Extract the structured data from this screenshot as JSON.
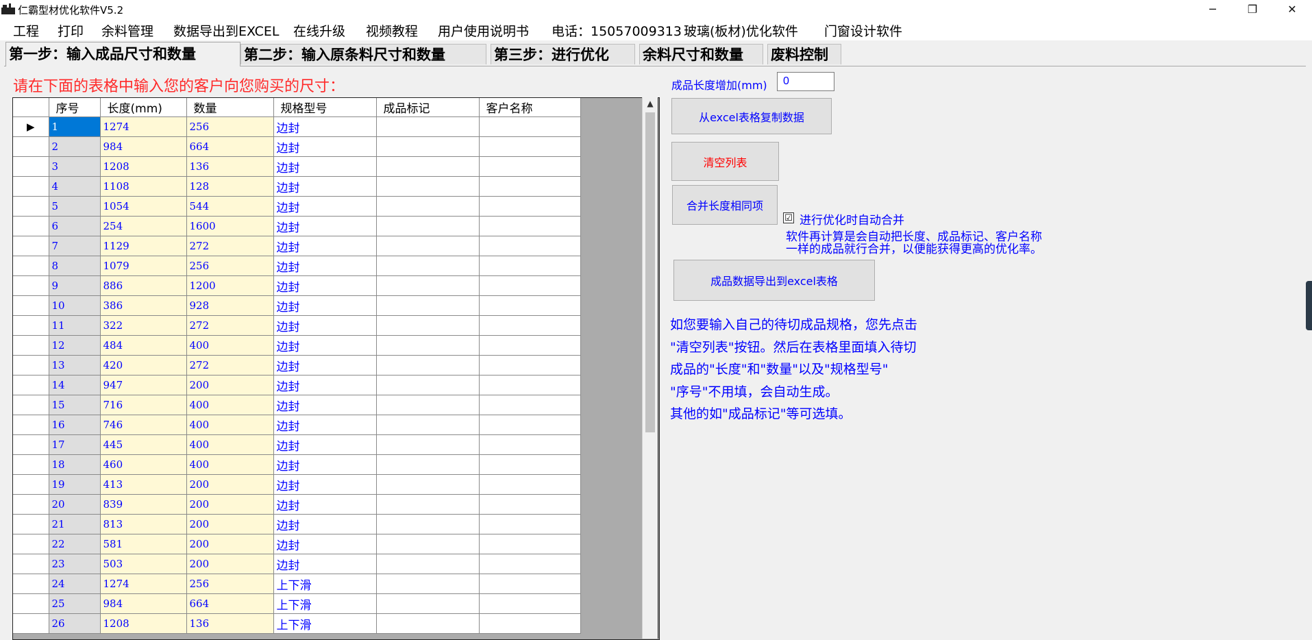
{
  "window": {
    "title": "仁霸型材优化软件V5.2",
    "controls": {
      "minimize": "─",
      "restore": "❐",
      "close": "✕"
    }
  },
  "menu": [
    "工程",
    "打印",
    "余料管理",
    "数据导出到EXCEL",
    "在线升级",
    "视频教程",
    "用户使用说明书",
    "电话：15057009313",
    "玻璃(板材)优化软件",
    "门窗设计软件"
  ],
  "tabs": [
    {
      "label": "第一步：输入成品尺寸和数量",
      "active": true
    },
    {
      "label": "第二步：输入原条料尺寸和数量",
      "active": false
    },
    {
      "label": "第三步：进行优化",
      "active": false
    },
    {
      "label": "余料尺寸和数量",
      "active": false
    },
    {
      "label": "废料控制",
      "active": false
    }
  ],
  "instruction": "请在下面的表格中输入您的客户向您购买的尺寸：",
  "grid": {
    "columns": [
      "序号",
      "长度(mm)",
      "数量",
      "规格型号",
      "成品标记",
      "客户名称"
    ],
    "selected_row_marker": "▶",
    "rows": [
      [
        "1",
        "1274",
        "256",
        "边封",
        "",
        ""
      ],
      [
        "2",
        "984",
        "664",
        "边封",
        "",
        ""
      ],
      [
        "3",
        "1208",
        "136",
        "边封",
        "",
        ""
      ],
      [
        "4",
        "1108",
        "128",
        "边封",
        "",
        ""
      ],
      [
        "5",
        "1054",
        "544",
        "边封",
        "",
        ""
      ],
      [
        "6",
        "254",
        "1600",
        "边封",
        "",
        ""
      ],
      [
        "7",
        "1129",
        "272",
        "边封",
        "",
        ""
      ],
      [
        "8",
        "1079",
        "256",
        "边封",
        "",
        ""
      ],
      [
        "9",
        "886",
        "1200",
        "边封",
        "",
        ""
      ],
      [
        "10",
        "386",
        "928",
        "边封",
        "",
        ""
      ],
      [
        "11",
        "322",
        "272",
        "边封",
        "",
        ""
      ],
      [
        "12",
        "484",
        "400",
        "边封",
        "",
        ""
      ],
      [
        "13",
        "420",
        "272",
        "边封",
        "",
        ""
      ],
      [
        "14",
        "947",
        "200",
        "边封",
        "",
        ""
      ],
      [
        "15",
        "716",
        "400",
        "边封",
        "",
        ""
      ],
      [
        "16",
        "746",
        "400",
        "边封",
        "",
        ""
      ],
      [
        "17",
        "445",
        "400",
        "边封",
        "",
        ""
      ],
      [
        "18",
        "460",
        "400",
        "边封",
        "",
        ""
      ],
      [
        "19",
        "413",
        "200",
        "边封",
        "",
        ""
      ],
      [
        "20",
        "839",
        "200",
        "边封",
        "",
        ""
      ],
      [
        "21",
        "813",
        "200",
        "边封",
        "",
        ""
      ],
      [
        "22",
        "581",
        "200",
        "边封",
        "",
        ""
      ],
      [
        "23",
        "503",
        "200",
        "边封",
        "",
        ""
      ],
      [
        "24",
        "1274",
        "256",
        "上下滑",
        "",
        ""
      ],
      [
        "25",
        "984",
        "664",
        "上下滑",
        "",
        ""
      ],
      [
        "26",
        "1208",
        "136",
        "上下滑",
        "",
        ""
      ]
    ]
  },
  "right": {
    "length_increase_label": "成品长度增加(mm)",
    "length_increase_value": "0",
    "copy_excel_button": "从excel表格复制数据",
    "clear_button": "清空列表",
    "merge_button": "合并长度相同项",
    "auto_merge_checkbox": "进行优化时自动合并",
    "auto_merge_checked": "☑",
    "note_line1": "软件再计算是会自动把长度、成品标记、客户名称",
    "note_line2": "一样的成品就行合并，以便能获得更高的优化率。",
    "export_button": "成品数据导出到excel表格",
    "help": [
      "如您要输入自己的待切成品规格，您先点击",
      "\"清空列表\"按钮。然后在表格里面填入待切",
      "成品的\"长度\"和\"数量\"以及\"规格型号\"",
      "\"序号\"不用填，会自动生成。",
      "其他的如\"成品标记\"等可选填。"
    ]
  },
  "colors": {
    "accent_blue": "#0000ff",
    "warning_red": "#ff2a2a",
    "selection": "#0078d7",
    "input_yellow": "#fff9d6"
  }
}
